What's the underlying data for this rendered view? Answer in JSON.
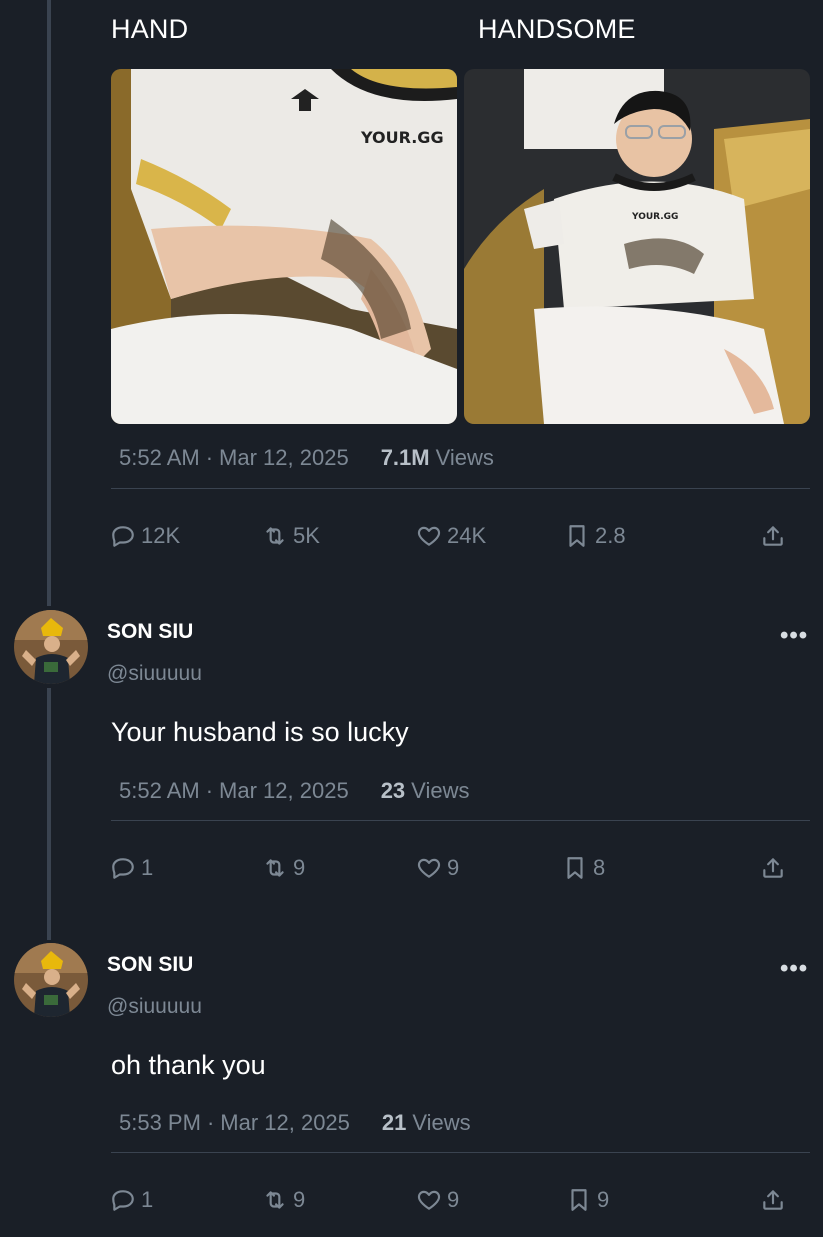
{
  "main": {
    "captions": [
      "HAND",
      "HANDSOME"
    ],
    "jersey_text": [
      "YOUR.GG",
      "YOUR.GG"
    ],
    "time": "5:52 AM",
    "date": "Mar 12, 2025",
    "views_count": "7.1M",
    "views_label": "Views",
    "actions": {
      "replies": "12K",
      "reposts": "5K",
      "likes": "24K",
      "bookmarks": "2.8"
    }
  },
  "replies": [
    {
      "name": "SON SIU",
      "handle": "@siuuuuu",
      "text": "Your husband is so lucky",
      "time": "5:52 AM",
      "date": "Mar 12, 2025",
      "views_count": "23",
      "views_label": "Views",
      "actions": {
        "replies": "1",
        "reposts": "9",
        "likes": "9",
        "bookmarks": "8"
      }
    },
    {
      "name": "SON SIU",
      "handle": "@siuuuuu",
      "text": "oh thank you",
      "time": "5:53 PM",
      "date": "Mar 12, 2025",
      "views_count": "21",
      "views_label": "Views",
      "actions": {
        "replies": "1",
        "reposts": "9",
        "likes": "9",
        "bookmarks": "9"
      }
    }
  ],
  "more_glyph": "•••",
  "dot_separator": "·",
  "icons": {
    "reply": "reply-icon",
    "repost": "repost-icon",
    "like": "heart-icon",
    "bookmark": "bookmark-icon",
    "share": "share-icon"
  },
  "colors": {
    "background": "#1a1f27",
    "muted_text": "#7d8894",
    "divider": "#3a4350",
    "text": "#ffffff"
  }
}
